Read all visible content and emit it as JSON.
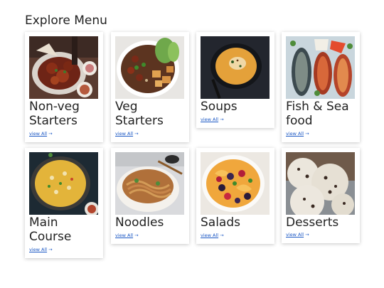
{
  "page": {
    "title": "Explore Menu"
  },
  "menu": {
    "link_arrow": "→",
    "categories": [
      {
        "name": "Non-veg Starters",
        "link": "view All",
        "icon": "chicken-dish-image"
      },
      {
        "name": "Veg Starters",
        "link": "view All",
        "icon": "tofu-bowl-image"
      },
      {
        "name": "Soups",
        "link": "view All",
        "icon": "soup-bowl-image"
      },
      {
        "name": "Fish & Sea food",
        "link": "view All",
        "icon": "grilled-fish-image"
      },
      {
        "name": "Main Course",
        "link": "view All",
        "icon": "biryani-pan-image"
      },
      {
        "name": "Noodles",
        "link": "view All",
        "icon": "noodle-bowl-image"
      },
      {
        "name": "Salads",
        "link": "view All",
        "icon": "fruit-salad-image"
      },
      {
        "name": "Desserts",
        "link": "view All",
        "icon": "ice-cream-scoops-image"
      }
    ]
  },
  "colors": {
    "link": "#1a57c4",
    "text": "#222222",
    "card_bg": "#ffffff"
  }
}
